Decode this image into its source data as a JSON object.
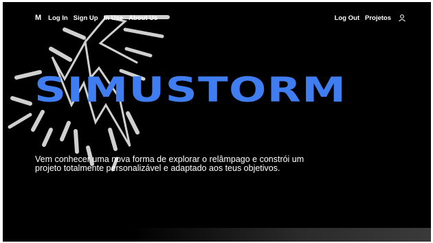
{
  "nav": {
    "logo": "M",
    "left_links": [
      "Log In",
      "Sign Up",
      "In Use",
      "About Us"
    ],
    "right_links": [
      "Log Out",
      "Projetos"
    ],
    "user_icon": "user-icon"
  },
  "hero": {
    "title": "SIMUSTORM",
    "description": "Vem conhecer uma nova forma de explorar o relâmpago e  constrói um projeto totalmente personalizável  e adaptado aos teus objetivos."
  },
  "colors": {
    "background": "#000000",
    "title": "#3f7df0",
    "text": "#ffffff",
    "lightning": "#d0d0d0"
  }
}
